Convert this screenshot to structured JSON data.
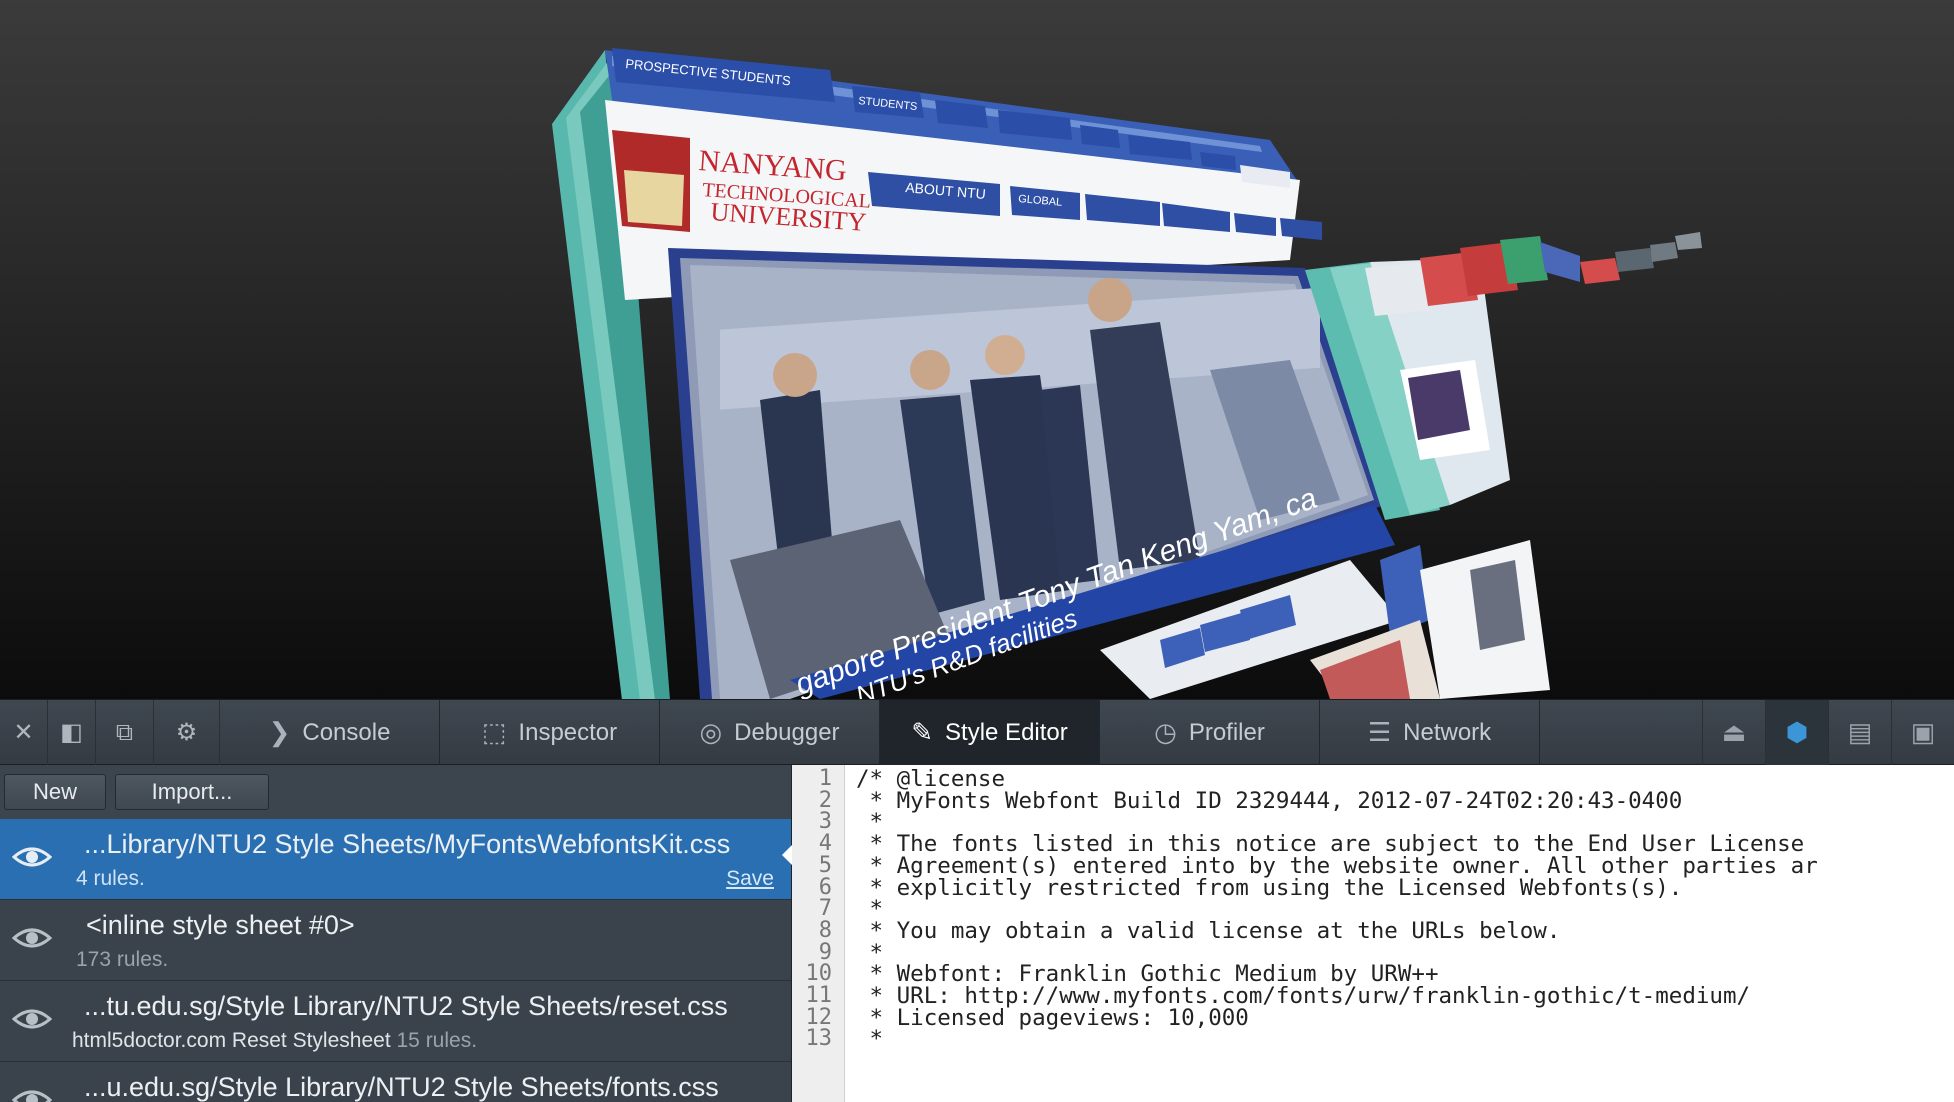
{
  "preview": {
    "nav_labels": [
      "PROSPECTIVE STUDENTS",
      "STUDENTS"
    ],
    "menu_labels": [
      "ABOUT NTU",
      "GLOBAL"
    ],
    "logo_text": [
      "NANYANG",
      "TECHNOLOGICAL",
      "UNIVERSITY"
    ],
    "banner_caption_1": "gapore President Tony Tan Keng Yam, ca",
    "banner_caption_2": "NTU's R&D facilities"
  },
  "toolbar": {
    "close_icon": "close-icon",
    "tabs": [
      {
        "label": "Console",
        "icon": "chevron-right-icon"
      },
      {
        "label": "Inspector",
        "icon": "inspector-icon"
      },
      {
        "label": "Debugger",
        "icon": "pause-icon"
      },
      {
        "label": "Style Editor",
        "icon": "pencil-icon",
        "selected": true
      },
      {
        "label": "Profiler",
        "icon": "clock-icon"
      },
      {
        "label": "Network",
        "icon": "bars-icon"
      }
    ],
    "right_buttons": [
      "broom-icon",
      "cube-icon",
      "clapperboard-icon",
      "responsive-icon"
    ],
    "accent": "#3c95d6"
  },
  "sidebar": {
    "new_label": "New",
    "import_label": "Import...",
    "sheets": [
      {
        "name": "...Library/NTU2 Style Sheets/MyFontsWebfontsKit.css",
        "desc": "",
        "rules": "4 rules.",
        "save": "Save",
        "selected": true
      },
      {
        "name": "<inline style sheet #0>",
        "desc": "",
        "rules": "173 rules."
      },
      {
        "name": "...tu.edu.sg/Style Library/NTU2 Style Sheets/reset.css",
        "desc": "html5doctor.com Reset Stylesheet",
        "rules": "15 rules."
      },
      {
        "name": "...u.edu.sg/Style Library/NTU2 Style Sheets/fonts.css",
        "desc": "",
        "rules": ""
      }
    ],
    "selected_color": "#2a6fb2"
  },
  "editor": {
    "lines": [
      "/* @license",
      " * MyFonts Webfont Build ID 2329444, 2012-07-24T02:20:43-0400",
      " *",
      " * The fonts listed in this notice are subject to the End User License",
      " * Agreement(s) entered into by the website owner. All other parties ar",
      " * explicitly restricted from using the Licensed Webfonts(s).",
      " *",
      " * You may obtain a valid license at the URLs below.",
      " *",
      " * Webfont: Franklin Gothic Medium by URW++",
      " * URL: http://www.myfonts.com/fonts/urw/franklin-gothic/t-medium/",
      " * Licensed pageviews: 10,000",
      " *"
    ],
    "line_numbers": [
      "1",
      "2",
      "3",
      "4",
      "5",
      "6",
      "7",
      "8",
      "9",
      "10",
      "11",
      "12",
      "13"
    ]
  }
}
